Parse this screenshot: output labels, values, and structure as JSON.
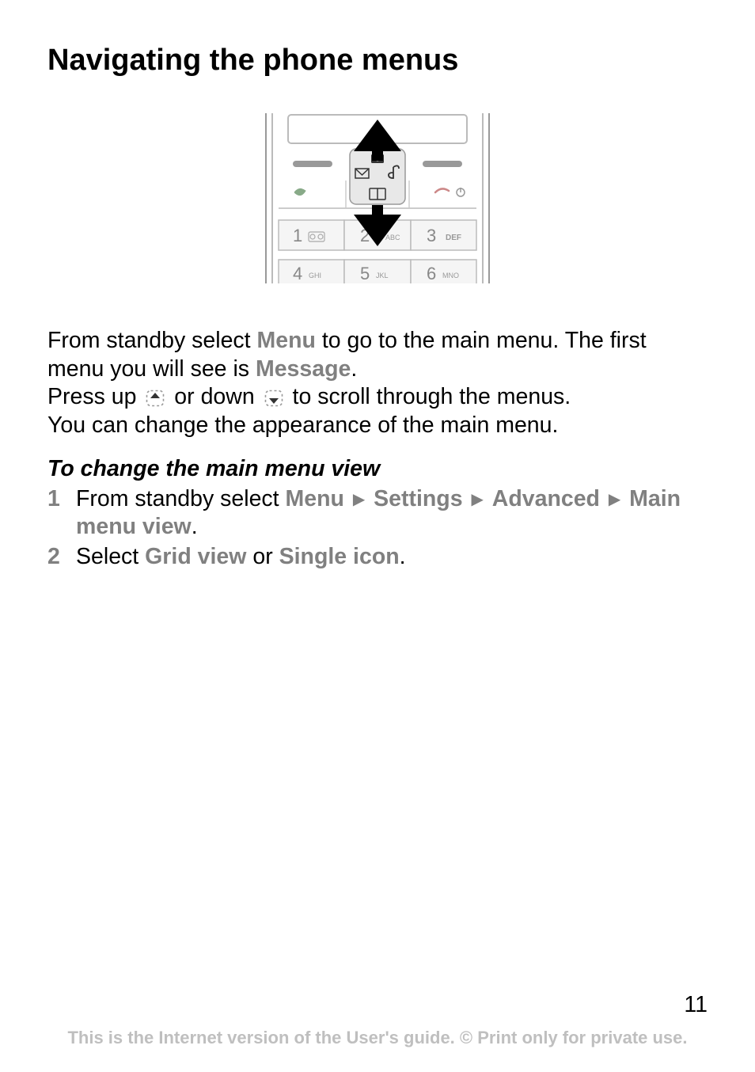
{
  "title": "Navigating the phone menus",
  "paragraph": {
    "p1_a": "From standby select ",
    "p1_menu": "Menu",
    "p1_b": " to go to the main menu. The first menu you will see is ",
    "p1_message": "Message",
    "p1_c": ".",
    "p2_a": "Press up ",
    "p2_b": " or down ",
    "p2_c": " to scroll through the menus.",
    "p3": "You can change the appearance of the main menu."
  },
  "subtitle": "To change the main menu view",
  "steps": {
    "s1_a": "From standby select ",
    "s1_menu": "Menu",
    "s1_settings": "Settings",
    "s1_advanced": "Advanced",
    "s1_mainmenu": "Main menu view",
    "s1_period": ".",
    "s2_a": "Select ",
    "s2_grid": "Grid view",
    "s2_or": " or ",
    "s2_single": "Single icon",
    "s2_period": "."
  },
  "keypad": {
    "k1_label": "1",
    "k2_label": "2",
    "k2_sub": "ABC",
    "k3_label": "3",
    "k3_sub": "DEF",
    "k4_label": "4",
    "k4_sub": "GHI",
    "k5_label": "5",
    "k5_sub": "JKL",
    "k6_label": "6",
    "k6_sub": "MNO"
  },
  "page_number": "11",
  "footer": "This is the Internet version of the User's guide. © Print only for private use."
}
